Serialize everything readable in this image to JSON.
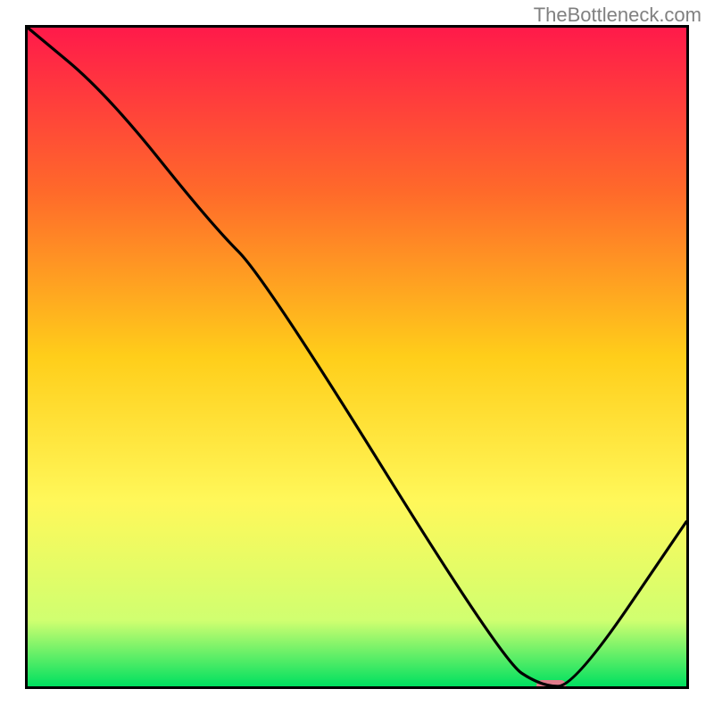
{
  "watermark": "TheBottleneck.com",
  "chart_data": {
    "type": "line",
    "title": "",
    "xlabel": "",
    "ylabel": "",
    "xlim": [
      0,
      100
    ],
    "ylim": [
      0,
      100
    ],
    "grid": false,
    "legend": false,
    "background_gradient": {
      "stops": [
        {
          "y_pct": 0,
          "color": "#ff1a4a"
        },
        {
          "y_pct": 25,
          "color": "#ff6a2a"
        },
        {
          "y_pct": 50,
          "color": "#ffce1a"
        },
        {
          "y_pct": 72,
          "color": "#fff85a"
        },
        {
          "y_pct": 90,
          "color": "#d0ff70"
        },
        {
          "y_pct": 100,
          "color": "#00e060"
        }
      ]
    },
    "series": [
      {
        "name": "bottleneck-curve",
        "color": "#000000",
        "x": [
          0,
          12,
          28,
          36,
          72,
          78,
          83,
          100
        ],
        "values": [
          100,
          90,
          70,
          62,
          4,
          0,
          0,
          25
        ]
      }
    ],
    "marker": {
      "name": "optimal-point",
      "x": 79.5,
      "y": 0,
      "width_pct": 4.5,
      "color": "#e07a8a"
    }
  }
}
